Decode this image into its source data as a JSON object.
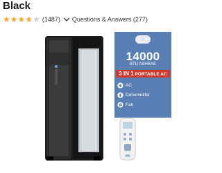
{
  "header": {
    "title": "Black"
  },
  "rating": {
    "stars_value": 4,
    "stars_max": 5,
    "review_count": "(1487)",
    "qa_label": "Questions & Answers (277)"
  },
  "product_image": {
    "btu_value": "14000",
    "btu_label": "BTU ASHRAE",
    "band_prefix": "3 IN 1",
    "band_text": "PORTABLE AC",
    "features": [
      "AC",
      "Dehumidifer",
      "Fan"
    ]
  },
  "colors": {
    "star": "#f5a623",
    "spec_panel": "#5a7fb4",
    "band": "#d0392b"
  }
}
